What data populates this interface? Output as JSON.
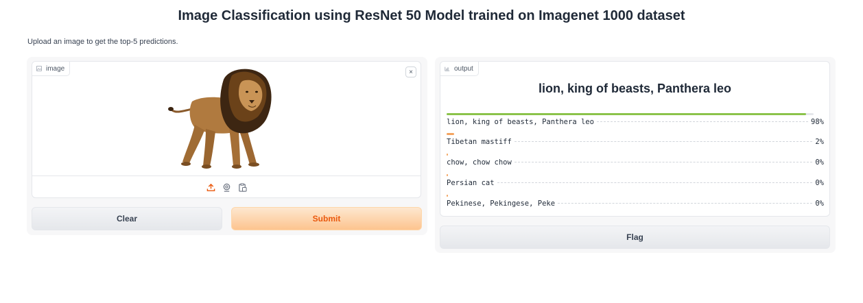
{
  "header": {
    "title": "Image Classification using ResNet 50 Model trained on Imagenet 1000 dataset",
    "description": "Upload an image to get the top-5 predictions."
  },
  "input_panel": {
    "image_label": "image",
    "close_symbol": "×",
    "tools": [
      "upload-icon",
      "webcam-icon",
      "clipboard-icon"
    ],
    "clear_label": "Clear",
    "submit_label": "Submit"
  },
  "output_panel": {
    "output_label": "output",
    "top_label": "lion, king of beasts, Panthera leo",
    "predictions": [
      {
        "label": "lion, king of beasts, Panthera leo",
        "percent": "98%",
        "confidence": 0.98
      },
      {
        "label": "Tibetan mastiff",
        "percent": "2%",
        "confidence": 0.02
      },
      {
        "label": "chow, chow chow",
        "percent": "0%",
        "confidence": 0.0
      },
      {
        "label": "Persian cat",
        "percent": "0%",
        "confidence": 0.0
      },
      {
        "label": "Pekinese, Pekingese, Peke",
        "percent": "0%",
        "confidence": 0.0
      }
    ],
    "flag_label": "Flag"
  },
  "colors": {
    "accent_orange": "#ea580c",
    "top_bar": "#8bc34a",
    "low_bar": "#f4a460",
    "track": "#e5e7eb"
  }
}
